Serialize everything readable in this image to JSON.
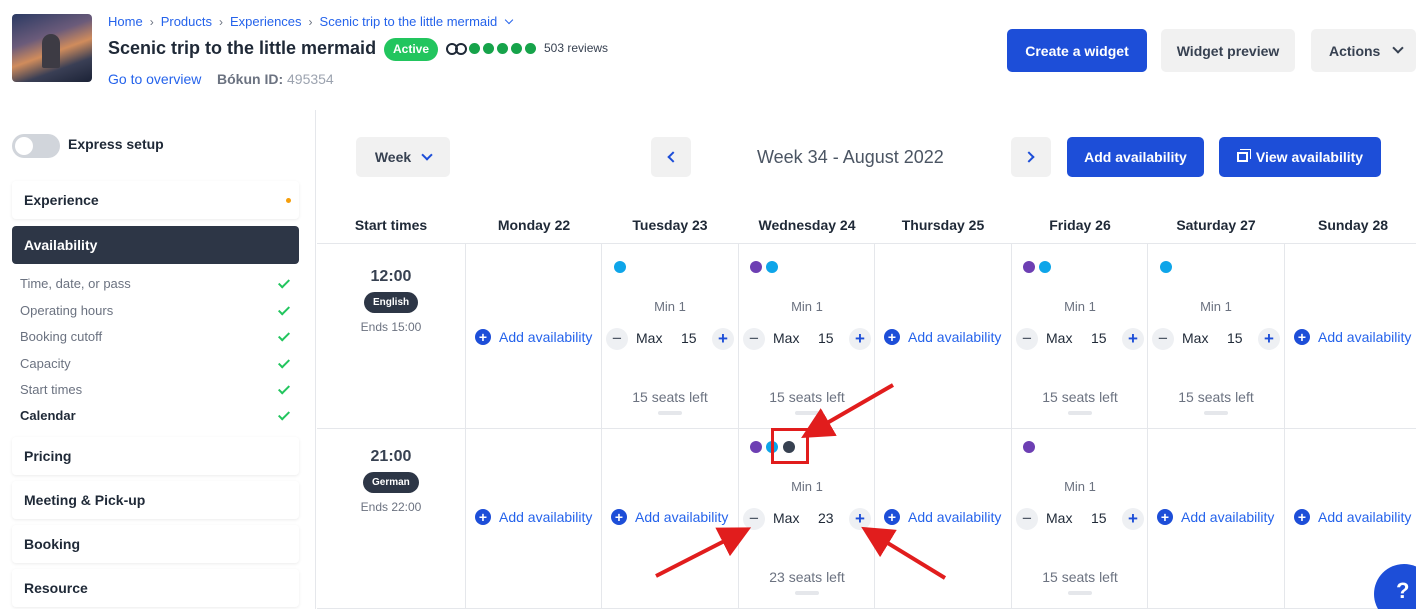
{
  "header": {
    "breadcrumbs": [
      "Home",
      "Products",
      "Experiences",
      "Scenic trip to the little mermaid"
    ],
    "title": "Scenic trip to the little mermaid",
    "status": "Active",
    "reviews": "503 reviews",
    "rating_dots": 5,
    "goto_overview": "Go to overview",
    "bokun_label": "Bókun ID:",
    "bokun_id": "495354",
    "buttons": {
      "create_widget": "Create a widget",
      "widget_preview": "Widget preview",
      "actions": "Actions"
    }
  },
  "sidebar": {
    "express_setup": "Express setup",
    "sections": [
      "Experience",
      "Availability",
      "Pricing",
      "Meeting & Pick-up",
      "Booking",
      "Resource"
    ],
    "availability_items": [
      "Time, date, or pass",
      "Operating hours",
      "Booking cutoff",
      "Capacity",
      "Start times",
      "Calendar"
    ]
  },
  "calendar": {
    "view": "Week",
    "week_label": "Week 34 - August 2022",
    "add_availability": "Add availability",
    "view_availability": "View availability",
    "columns": [
      "Start times",
      "Monday 22",
      "Tuesday 23",
      "Wednesday 24",
      "Thursday 25",
      "Friday 26",
      "Saturday 27",
      "Sunday 28"
    ],
    "rows": [
      {
        "time": "12:00",
        "language": "English",
        "ends": "Ends 15:00",
        "cells": [
          {
            "type": "add",
            "label": "Add availability"
          },
          {
            "type": "slot",
            "min": "Min 1",
            "max_label": "Max",
            "max": "15",
            "seats": "15 seats left",
            "dots": [
              "cyan"
            ]
          },
          {
            "type": "slot",
            "min": "Min 1",
            "max_label": "Max",
            "max": "15",
            "seats": "15 seats left",
            "dots": [
              "purple",
              "cyan"
            ]
          },
          {
            "type": "add",
            "label": "Add availability"
          },
          {
            "type": "slot",
            "min": "Min 1",
            "max_label": "Max",
            "max": "15",
            "seats": "15 seats left",
            "dots": [
              "purple",
              "cyan"
            ]
          },
          {
            "type": "slot",
            "min": "Min 1",
            "max_label": "Max",
            "max": "15",
            "seats": "15 seats left",
            "dots": [
              "cyan"
            ]
          },
          {
            "type": "add",
            "label": "Add availability"
          }
        ]
      },
      {
        "time": "21:00",
        "language": "German",
        "ends": "Ends 22:00",
        "cells": [
          {
            "type": "add",
            "label": "Add availability"
          },
          {
            "type": "add",
            "label": "Add availability"
          },
          {
            "type": "slot",
            "min": "Min 1",
            "max_label": "Max",
            "max": "23",
            "seats": "23 seats left",
            "dots": [
              "purple",
              "cyan",
              "dark"
            ]
          },
          {
            "type": "add",
            "label": "Add availability"
          },
          {
            "type": "slot",
            "min": "Min 1",
            "max_label": "Max",
            "max": "15",
            "seats": "15 seats left",
            "dots": [
              "purple"
            ]
          },
          {
            "type": "add",
            "label": "Add availability"
          },
          {
            "type": "add",
            "label": "Add availability"
          }
        ]
      }
    ]
  },
  "colors": {
    "primary": "#1d4ed8",
    "active": "#22c55e",
    "dark": "#2d3646",
    "annotation": "#e11d1d"
  },
  "help_label": "?"
}
